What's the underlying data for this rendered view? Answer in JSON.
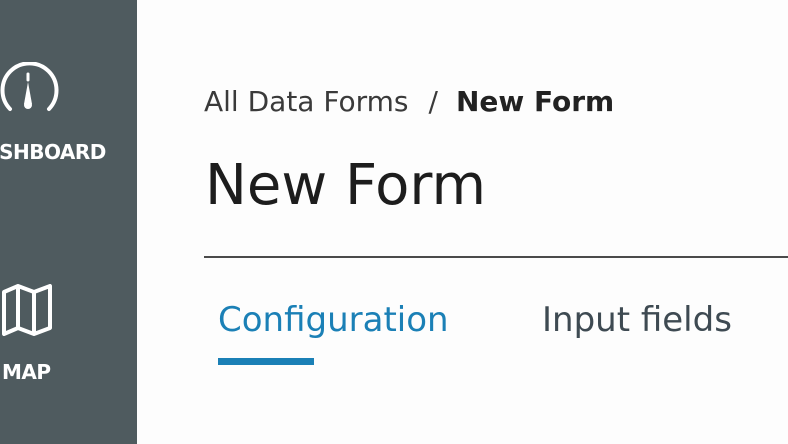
{
  "sidebar": {
    "items": [
      {
        "label": "DASHBOARD",
        "icon": "gauge-icon"
      },
      {
        "label": "MAP",
        "icon": "map-icon"
      }
    ]
  },
  "breadcrumb": {
    "parent": "All Data Forms",
    "separator": "/",
    "current": "New Form"
  },
  "page": {
    "title": "New Form"
  },
  "tabs": [
    {
      "label": "Configuration",
      "active": true
    },
    {
      "label": "Input fields",
      "active": false
    }
  ],
  "colors": {
    "sidebar_bg": "#4f5b5f",
    "accent": "#1b80b6",
    "text": "#1d1d1d"
  }
}
